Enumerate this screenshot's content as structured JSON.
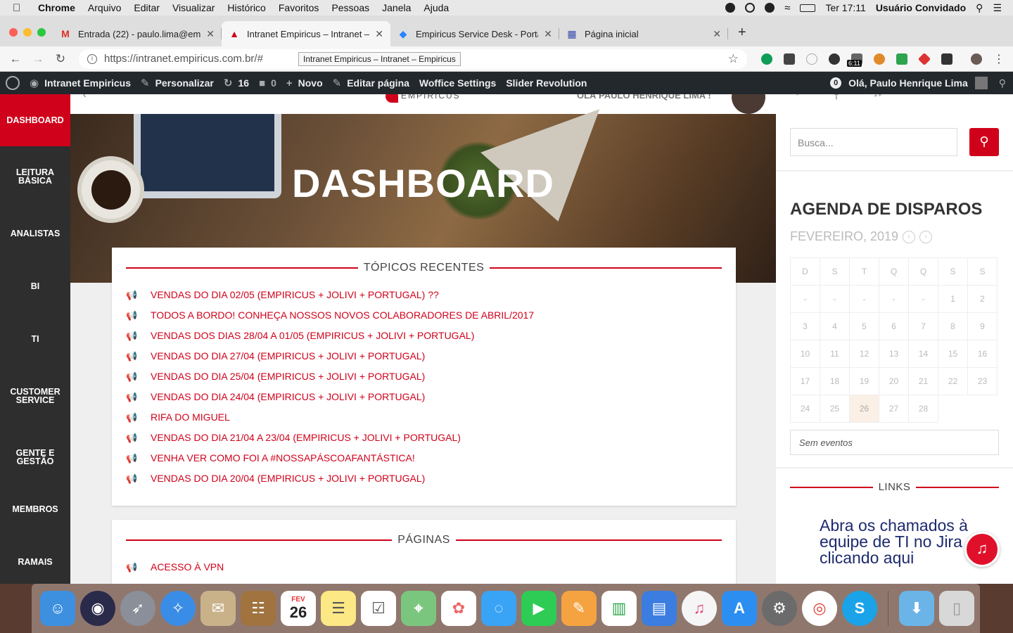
{
  "macos": {
    "app_name": "Chrome",
    "menu": [
      "Arquivo",
      "Editar",
      "Visualizar",
      "Histórico",
      "Favoritos",
      "Pessoas",
      "Janela",
      "Ajuda"
    ],
    "clock": "Ter 17:11",
    "user": "Usuário Convidado"
  },
  "browser": {
    "tabs": [
      {
        "title": "Entrada (22) - paulo.lima@emp",
        "icon": "gmail-icon",
        "active": false
      },
      {
        "title": "Intranet Empiricus – Intranet – E",
        "icon": "empiricus-icon",
        "active": true
      },
      {
        "title": "Empiricus Service Desk - Porta",
        "icon": "jira-icon",
        "active": false
      },
      {
        "title": "Página inicial",
        "icon": "page-icon",
        "active": false
      }
    ],
    "url": "https://intranet.empiricus.com.br/#",
    "tooltip": "Intranet Empiricus – Intranet – Empiricus",
    "ext_badge": "6:11"
  },
  "wp_admin": {
    "site": "Intranet Empiricus",
    "customize": "Personalizar",
    "updates": "16",
    "comments": "0",
    "new": "Novo",
    "edit": "Editar página",
    "woffice": "Woffice Settings",
    "slider": "Slider Revolution",
    "notif_count": "0",
    "greeting": "Olá, Paulo Henrique Lima"
  },
  "sidebar": [
    {
      "label": "DASHBOARD",
      "active": true
    },
    {
      "label": "LEITURA BÁSICA",
      "active": false
    },
    {
      "label": "ANALISTAS",
      "active": false
    },
    {
      "label": "BI",
      "active": false
    },
    {
      "label": "TI",
      "active": false
    },
    {
      "label": "CUSTOMER SERVICE",
      "active": false
    },
    {
      "label": "GENTE E GESTÃO",
      "active": false
    },
    {
      "label": "MEMBROS",
      "active": false
    },
    {
      "label": "RAMAIS",
      "active": false
    }
  ],
  "header": {
    "logo": "EMPIRICUS",
    "greeting": "OLÁ PAULO HENRIQUE LIMA !"
  },
  "hero_title": "DASHBOARD",
  "recent_topics": {
    "title": "TÓPICOS RECENTES",
    "items": [
      "VENDAS DO DIA 02/05 (EMPIRICUS + JOLIVI + PORTUGAL) ??",
      "TODOS A BORDO! CONHEÇA NOSSOS NOVOS COLABORADORES DE ABRIL/2017",
      "VENDAS DOS DIAS 28/04 A 01/05 (EMPIRICUS + JOLIVI + PORTUGAL)",
      "VENDAS DO DIA 27/04 (EMPIRICUS + JOLIVI + PORTUGAL)",
      "VENDAS DO DIA 25/04 (EMPIRICUS + JOLIVI + PORTUGAL)",
      "VENDAS DO DIA 24/04 (EMPIRICUS + JOLIVI + PORTUGAL)",
      "RIFA DO MIGUEL",
      "VENDAS DO DIA 21/04 A 23/04 (EMPIRICUS + JOLIVI + PORTUGAL)",
      "VENHA VER COMO FOI A #NOSSAPÁSCOAFANTÁSTICA!",
      "VENDAS DO DIA 20/04 (EMPIRICUS + JOLIVI + PORTUGAL)"
    ]
  },
  "pages": {
    "title": "PÁGINAS",
    "items": [
      "ACESSO À VPN"
    ]
  },
  "search": {
    "placeholder": "Busca..."
  },
  "agenda": {
    "title": "AGENDA DE DISPAROS",
    "month": "FEVEREIRO, 2019",
    "weekdays": [
      "D",
      "S",
      "T",
      "Q",
      "Q",
      "S",
      "S"
    ],
    "weeks": [
      [
        "-",
        "-",
        "-",
        "-",
        "-",
        "1",
        "2"
      ],
      [
        "3",
        "4",
        "5",
        "6",
        "7",
        "8",
        "9"
      ],
      [
        "10",
        "11",
        "12",
        "13",
        "14",
        "15",
        "16"
      ],
      [
        "17",
        "18",
        "19",
        "20",
        "21",
        "22",
        "23"
      ],
      [
        "24",
        "25",
        "26",
        "27",
        "28",
        "",
        ""
      ]
    ],
    "today": "26",
    "no_events": "Sem eventos"
  },
  "links": {
    "title": "LINKS",
    "jira_text": "Abra os chamados à equipe de TI no Jira clicando aqui"
  },
  "dock": {
    "calendar_month": "FEV",
    "calendar_day": "26"
  },
  "colors": {
    "accent": "#d0021b",
    "sidebar": "#2e2e2e",
    "wpbar": "#23282d"
  }
}
